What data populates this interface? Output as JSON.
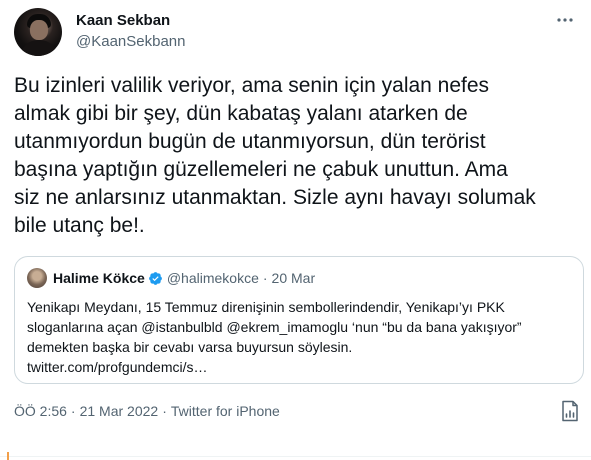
{
  "author": {
    "display_name": "Kaan Sekban",
    "handle": "@KaanSekbann"
  },
  "more_icon": "more-horizontal-icon",
  "tweet": {
    "lines": [
      "Bu izinleri valilik veriyor, ama senin için yalan nefes",
      "almak gibi bir şey, dün kabataş yalanı atarken de",
      "utanmıyordun bugün de utanmıyorsun, dün terörist",
      "başına yaptığın güzellemeleri ne çabuk unuttun. Ama",
      "siz ne anlarsınız utanmaktan. Sizle aynı havayı solumak",
      "bile utanç be!."
    ]
  },
  "quoted": {
    "display_name": "Halime Kökce",
    "verified_icon": "verified-badge-icon",
    "handle": "@halimekokce",
    "separator": "·",
    "date": "20 Mar",
    "lines": [
      "Yenikapı Meydanı, 15 Temmuz direnişinin sembollerindendir, Yenikapı’yı PKK",
      "sloganlarına açan  @istanbulbld @ekrem_imamoglu ‘nun “bu da bana yakışıyor”",
      "demekten başka bir cevabı varsa buyursun söylesin.",
      "twitter.com/profgundemci/s…"
    ]
  },
  "meta": {
    "time": "ÖÖ 2:56",
    "separator": "·",
    "date": "21 Mar 2022",
    "source": "Twitter for iPhone"
  },
  "analytics_icon": "tweet-analytics-icon",
  "colors": {
    "text": "#0f1419",
    "secondary": "#536471",
    "border": "#cfd9de",
    "verified": "#1d9bf0"
  }
}
